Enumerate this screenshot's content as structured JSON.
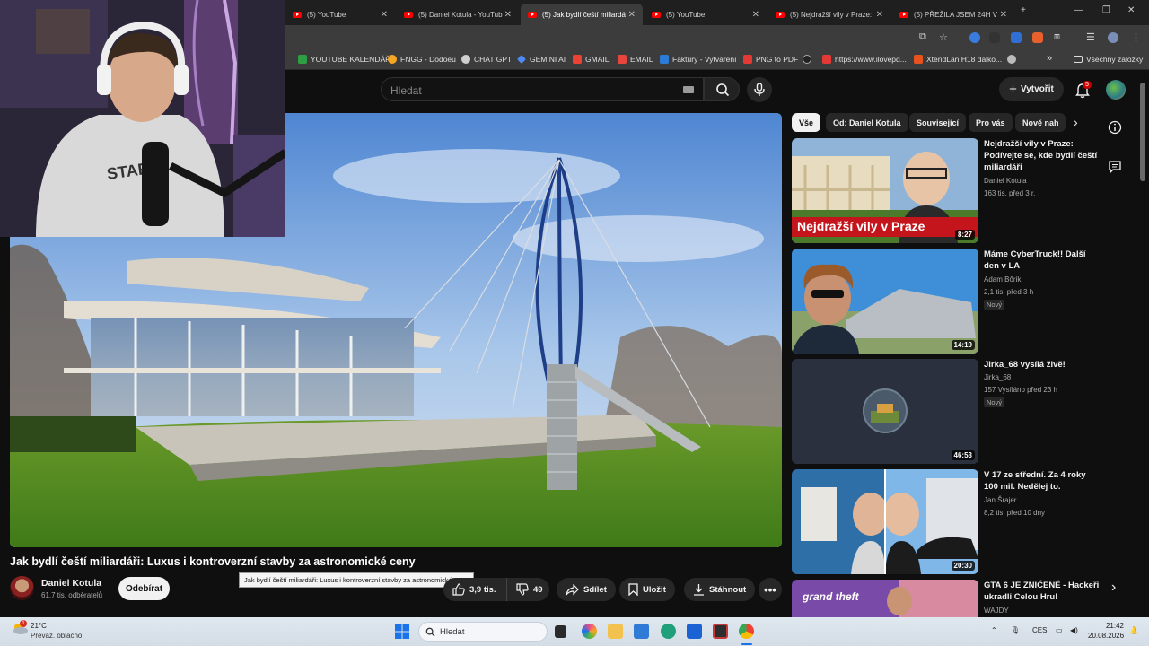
{
  "browser": {
    "tabs": [
      {
        "label": "(5) YouTube",
        "active": false
      },
      {
        "label": "(5) Daniel Kotula - YouTub",
        "active": false
      },
      {
        "label": "(5) Jak bydlí čeští miliardá",
        "active": true
      },
      {
        "label": "(5) YouTube",
        "active": false
      },
      {
        "label": "(5) Nejdražší vily v Praze:",
        "active": false
      },
      {
        "label": "(5) PŘEŽILA JSEM 24H V",
        "active": false
      }
    ],
    "bookmarks": [
      {
        "label": "YOUTUBE KALENDÁŘ",
        "color": "#2ea043"
      },
      {
        "label": "FNGG - Dodoeu",
        "color": "#f5a623"
      },
      {
        "label": "CHAT GPT",
        "color": "#cfcfcf"
      },
      {
        "label": "GEMINI AI",
        "color": "#4c8bf5"
      },
      {
        "label": "GMAIL",
        "color": "#ea4335"
      },
      {
        "label": "EMAIL",
        "color": "#e8453c"
      },
      {
        "label": "Faktury - Vytváření",
        "color": "#2b7bd8"
      },
      {
        "label": "PNG to PDF",
        "color": "#e53935"
      },
      {
        "label": "https://www.ilovepd...",
        "color": "#e53935"
      },
      {
        "label": "XtendLan H18 dálko...",
        "color": "#e8521e"
      }
    ],
    "all_bookmarks_label": "Všechny záložky"
  },
  "youtube": {
    "search_placeholder": "Hledat",
    "create_label": "Vytvořit",
    "notification_count": "5",
    "video": {
      "title": "Jak bydlí čeští miliardáři: Luxus i kontroverzní stavby za astronomické ceny",
      "tooltip": "Jak bydlí čeští miliardáři: Luxus i kontroverzní stavby za astronomické ceny",
      "channel": "Daniel Kotula",
      "subscribers": "61,7 tis. odběratelů",
      "subscribe_label": "Odebírat",
      "likes": "3,9 tis.",
      "dislikes": "49",
      "share_label": "Sdílet",
      "save_label": "Uložit",
      "download_label": "Stáhnout"
    },
    "chips": [
      "Vše",
      "Od: Daniel Kotula",
      "Související",
      "Pro vás",
      "Nově nah"
    ],
    "recommendations": [
      {
        "title": "Nejdražší vily v Praze: Podívejte se, kde bydlí čeští miliardáři",
        "channel": "Daniel Kotula",
        "meta": "163 tis.  před 3 r.",
        "duration": "8:27",
        "thumb_text": "Nejdražší vily v Praze",
        "badge": ""
      },
      {
        "title": "Máme CyberTruck!! Další den v LA",
        "channel": "Adam Bőrik",
        "meta": "2,1 tis.  před 3 h",
        "duration": "14:19",
        "badge": "Nový"
      },
      {
        "title": "Jirka_68 vysílá živě!",
        "channel": "Jirka_68",
        "meta": "157  Vysíláno před 23 h",
        "duration": "46:53",
        "badge": "Nový"
      },
      {
        "title": "V 17 ze střední. Za 4 roky 100 mil. Nedělej to.",
        "channel": "Jan Šrajer",
        "meta": "8,2 tis.  před 10 dny",
        "duration": "20:30",
        "badge": ""
      },
      {
        "title": "GTA 6 JE ZNIČENÉ - Hackeři ukradli Celou Hru!",
        "channel": "WAJDY",
        "meta": "",
        "duration": "",
        "thumb_text": "grand theft",
        "badge": ""
      }
    ]
  },
  "taskbar": {
    "weather_temp": "21°C",
    "weather_cond": "Převáž. oblačno",
    "weather_alert": "1",
    "search_label": "Hledat",
    "lang": "CES",
    "time": "21:42",
    "date": "20.08.2026"
  },
  "colors": {
    "yt_red": "#ff0000",
    "background": "#0f0f0f",
    "chip_bg": "#272727"
  }
}
